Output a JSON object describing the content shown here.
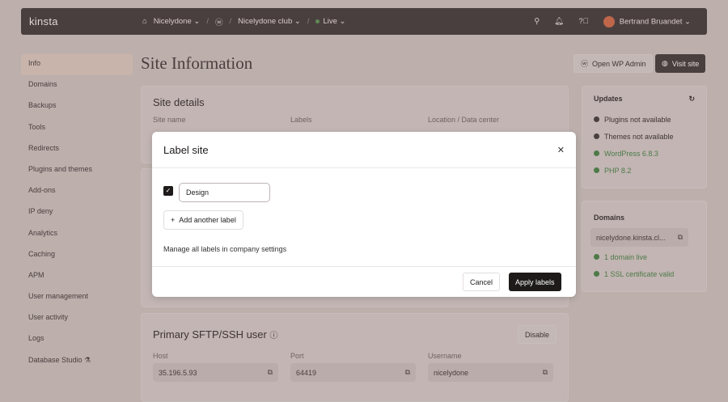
{
  "header": {
    "logo": "kinsta",
    "company": "Nicelydone",
    "site": "Nicelydone club",
    "env": "Live",
    "user": "Bertrand Bruandet"
  },
  "sidebar": {
    "items": [
      "Info",
      "Domains",
      "Backups",
      "Tools",
      "Redirects",
      "Plugins and themes",
      "Add-ons",
      "IP deny",
      "Analytics",
      "Caching",
      "APM",
      "User management",
      "User activity",
      "Logs",
      "Database Studio"
    ]
  },
  "page": {
    "title": "Site Information",
    "open_wp_admin": "Open WP Admin",
    "visit_site": "Visit site"
  },
  "site_details": {
    "title": "Site details",
    "site_name_label": "Site name",
    "labels_label": "Labels",
    "location_label": "Location / Data center"
  },
  "modal": {
    "title": "Label site",
    "label_value": "Design",
    "add_label": "Add another label",
    "manage_text": "Manage all labels in company settings",
    "cancel": "Cancel",
    "apply": "Apply labels"
  },
  "sftp": {
    "title": "Primary SFTP/SSH user",
    "disable": "Disable",
    "host_label": "Host",
    "host": "35.196.5.93",
    "port_label": "Port",
    "port": "64419",
    "username_label": "Username",
    "username": "nicelydone"
  },
  "updates": {
    "title": "Updates",
    "items": [
      "Plugins not available",
      "Themes not available",
      "WordPress 6.8.3",
      "PHP 8.2"
    ]
  },
  "domains": {
    "title": "Domains",
    "domain": "nicelydone.kinsta.cl...",
    "items": [
      "1 domain live",
      "1 SSL certificate valid"
    ]
  }
}
